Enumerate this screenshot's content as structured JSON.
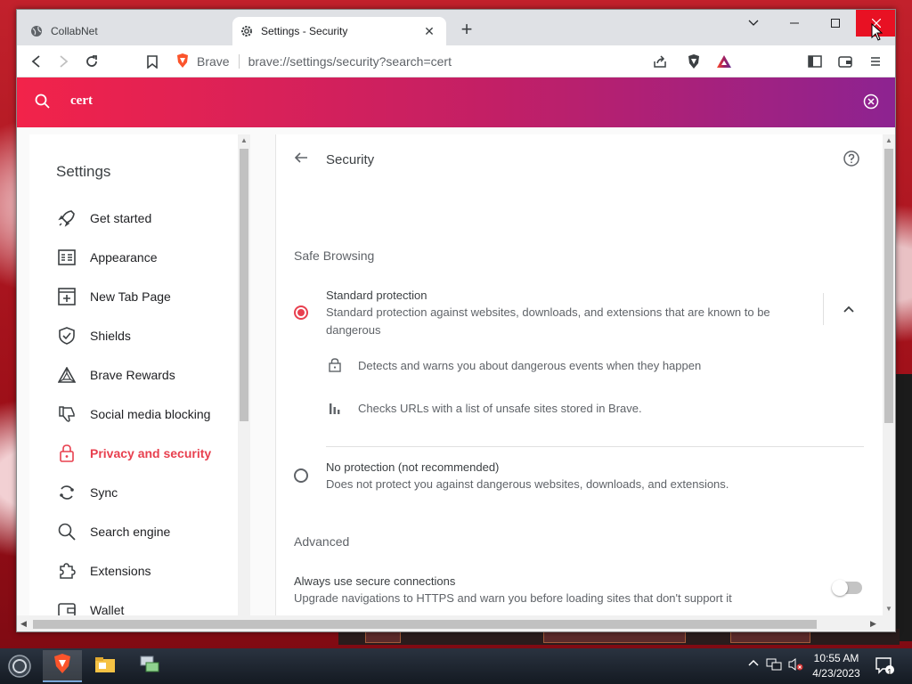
{
  "tabs": [
    {
      "title": "CollabNet",
      "icon": "globe-icon",
      "active": false
    },
    {
      "title": "Settings - Security",
      "icon": "gear-icon",
      "active": true
    }
  ],
  "toolbar": {
    "site_name": "Brave",
    "url": "brave://settings/security?search=cert"
  },
  "search": {
    "query": "cert"
  },
  "sidebar": {
    "title": "Settings",
    "items": [
      {
        "label": "Get started",
        "icon": "rocket-icon"
      },
      {
        "label": "Appearance",
        "icon": "appearance-icon"
      },
      {
        "label": "New Tab Page",
        "icon": "new-tab-icon"
      },
      {
        "label": "Shields",
        "icon": "shield-icon"
      },
      {
        "label": "Brave Rewards",
        "icon": "rewards-icon"
      },
      {
        "label": "Social media blocking",
        "icon": "thumbs-down-icon"
      },
      {
        "label": "Privacy and security",
        "icon": "lock-icon",
        "active": true
      },
      {
        "label": "Sync",
        "icon": "sync-icon"
      },
      {
        "label": "Search engine",
        "icon": "search-icon"
      },
      {
        "label": "Extensions",
        "icon": "puzzle-icon"
      },
      {
        "label": "Wallet",
        "icon": "wallet-icon"
      }
    ]
  },
  "main": {
    "title": "Security",
    "safe_browsing": {
      "heading": "Safe Browsing",
      "standard": {
        "title": "Standard protection",
        "desc": "Standard protection against websites, downloads, and extensions that are known to be dangerous",
        "selected": true
      },
      "details": [
        {
          "icon": "lock-icon",
          "text": "Detects and warns you about dangerous events when they happen"
        },
        {
          "icon": "bar-chart-icon",
          "text": "Checks URLs with a list of unsafe sites stored in Brave."
        }
      ],
      "none": {
        "title": "No protection (not recommended)",
        "desc": "Does not protect you against dangerous websites, downloads, and extensions.",
        "selected": false
      }
    },
    "advanced": {
      "heading": "Advanced",
      "https": {
        "title": "Always use secure connections",
        "desc": "Upgrade navigations to HTTPS and warn you before loading sites that don't support it",
        "enabled": false
      }
    }
  },
  "taskbar": {
    "time": "10:55 AM",
    "date": "4/23/2023",
    "notification_count": "1"
  },
  "colors": {
    "accent": "#e8404f",
    "banner_start": "#f2234a",
    "banner_end": "#8d2391"
  }
}
